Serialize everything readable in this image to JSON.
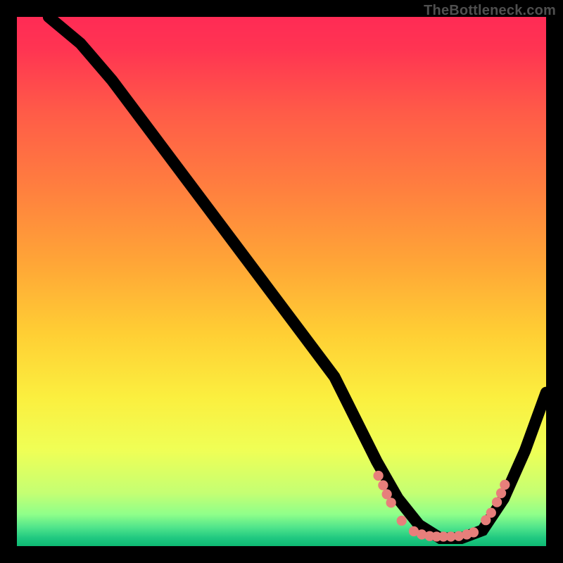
{
  "watermark": "TheBottleneck.com",
  "chart_data": {
    "type": "line",
    "title": "",
    "xlabel": "",
    "ylabel": "",
    "xlim": [
      0,
      100
    ],
    "ylim": [
      0,
      100
    ],
    "grid": false,
    "gradient_stops": [
      {
        "offset": 0.0,
        "color": "#ff2b55"
      },
      {
        "offset": 0.06,
        "color": "#ff3452"
      },
      {
        "offset": 0.18,
        "color": "#ff5b48"
      },
      {
        "offset": 0.32,
        "color": "#ff7e3f"
      },
      {
        "offset": 0.46,
        "color": "#ffa437"
      },
      {
        "offset": 0.6,
        "color": "#ffcf34"
      },
      {
        "offset": 0.72,
        "color": "#fbef3f"
      },
      {
        "offset": 0.82,
        "color": "#efff56"
      },
      {
        "offset": 0.9,
        "color": "#c4ff73"
      },
      {
        "offset": 0.94,
        "color": "#8fff8a"
      },
      {
        "offset": 0.965,
        "color": "#4fe48b"
      },
      {
        "offset": 0.985,
        "color": "#1fc880"
      },
      {
        "offset": 1.0,
        "color": "#0eb973"
      }
    ],
    "series": [
      {
        "name": "bottleneck-curve",
        "x": [
          6,
          12,
          18,
          24,
          30,
          36,
          42,
          48,
          54,
          60,
          64,
          68,
          72,
          76,
          80,
          84,
          88,
          92,
          96,
          100
        ],
        "values": [
          100,
          95,
          88,
          80,
          72,
          64,
          56,
          48,
          40,
          32,
          24,
          16,
          9,
          4,
          1.5,
          1.5,
          3,
          9,
          18,
          29
        ]
      }
    ],
    "dots": [
      {
        "x": 68.3,
        "y": 13.3
      },
      {
        "x": 69.2,
        "y": 11.5
      },
      {
        "x": 69.9,
        "y": 9.8
      },
      {
        "x": 70.7,
        "y": 8.2
      },
      {
        "x": 72.7,
        "y": 4.8
      },
      {
        "x": 75.0,
        "y": 2.8
      },
      {
        "x": 76.5,
        "y": 2.2
      },
      {
        "x": 78.0,
        "y": 1.9
      },
      {
        "x": 79.3,
        "y": 1.8
      },
      {
        "x": 80.6,
        "y": 1.8
      },
      {
        "x": 82.0,
        "y": 1.8
      },
      {
        "x": 83.5,
        "y": 1.9
      },
      {
        "x": 85.0,
        "y": 2.2
      },
      {
        "x": 86.3,
        "y": 2.6
      },
      {
        "x": 88.6,
        "y": 4.9
      },
      {
        "x": 89.6,
        "y": 6.3
      },
      {
        "x": 90.7,
        "y": 8.3
      },
      {
        "x": 91.5,
        "y": 10.0
      },
      {
        "x": 92.2,
        "y": 11.6
      }
    ]
  }
}
